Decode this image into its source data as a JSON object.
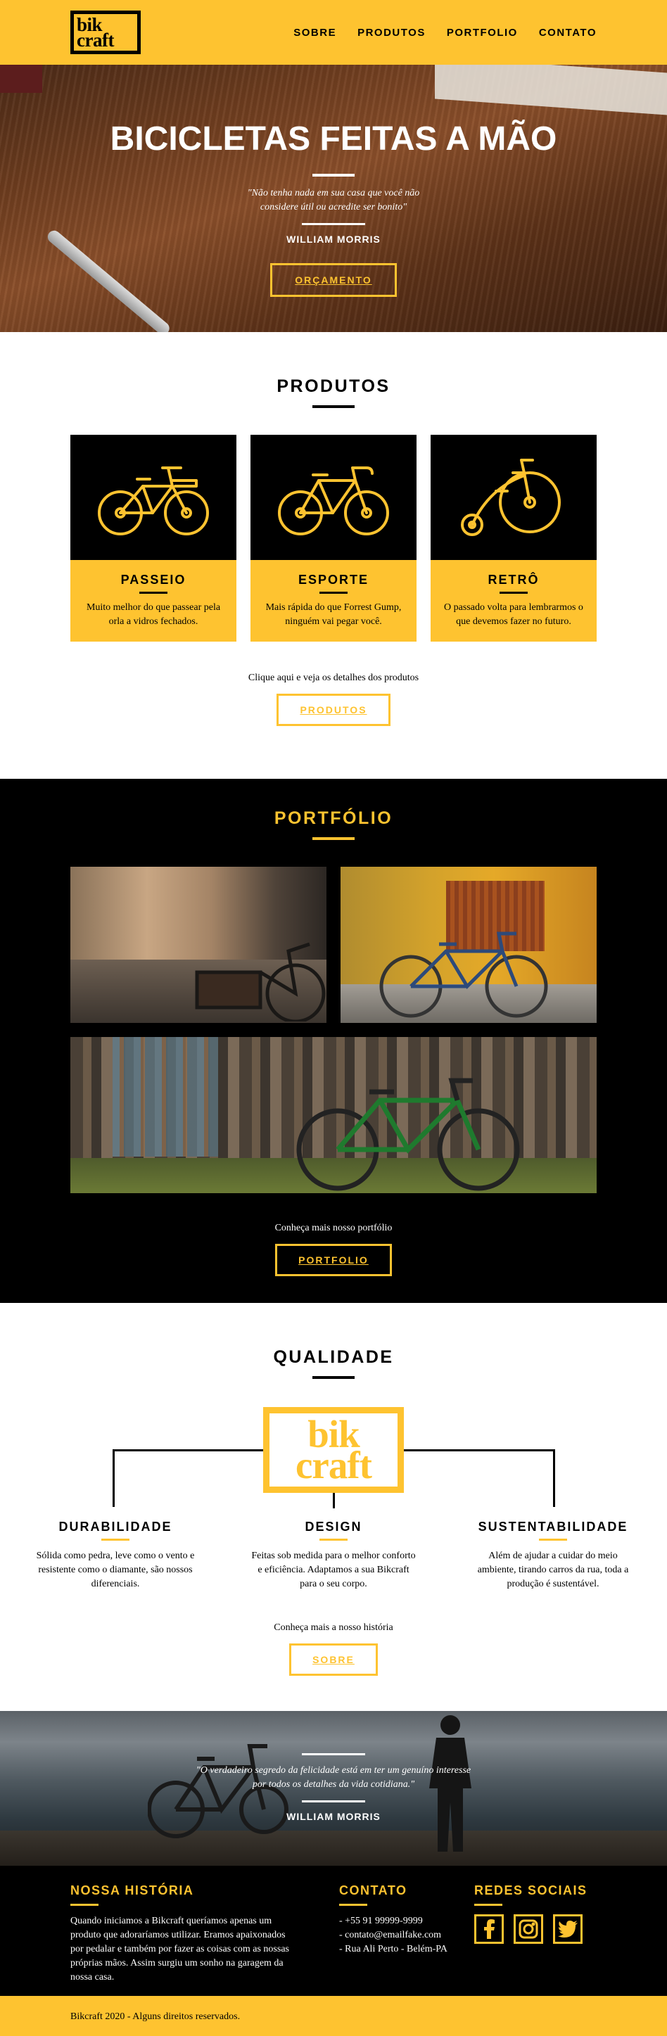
{
  "brand": {
    "logo_line1": "bik",
    "logo_line2": "craft"
  },
  "nav": {
    "items": [
      {
        "label": "SOBRE"
      },
      {
        "label": "PRODUTOS"
      },
      {
        "label": "PORTFOLIO"
      },
      {
        "label": "CONTATO"
      }
    ]
  },
  "hero": {
    "title": "BICICLETAS FEITAS A MÃO",
    "quote": "\"Não tenha nada em sua casa que você não considere útil ou acredite ser bonito\"",
    "author": "WILLIAM MORRIS",
    "button": "ORÇAMENTO"
  },
  "produtos": {
    "title": "PRODUTOS",
    "cards": [
      {
        "name": "PASSEIO",
        "desc": "Muito melhor do que passear pela orla a vidros fechados.",
        "icon": "city-bike-icon"
      },
      {
        "name": "ESPORTE",
        "desc": "Mais rápida do que Forrest Gump, ninguém vai pegar você.",
        "icon": "sport-bike-icon"
      },
      {
        "name": "RETRÔ",
        "desc": "O passado volta para lembrarmos o que devemos fazer no futuro.",
        "icon": "retro-bike-icon"
      }
    ],
    "cta_text": "Clique aqui e veja os detalhes dos produtos",
    "button": "PRODUTOS"
  },
  "portfolio": {
    "title": "PORTFÓLIO",
    "cta_text": "Conheça mais nosso portfólio",
    "button": "PORTFOLIO"
  },
  "qualidade": {
    "title": "QUALIDADE",
    "logo_line1": "bik",
    "logo_line2": "craft",
    "items": [
      {
        "name": "DURABILIDADE",
        "desc": "Sólida como pedra, leve como o vento e resistente como o diamante, são nossos diferenciais."
      },
      {
        "name": "DESIGN",
        "desc": "Feitas sob medida para o melhor conforto e eficiência. Adaptamos a sua Bikcraft para o seu corpo."
      },
      {
        "name": "SUSTENTABILIDADE",
        "desc": "Além de ajudar a cuidar do meio ambiente, tirando carros da rua, toda a produção é sustentável."
      }
    ],
    "cta_text": "Conheça mais a nosso história",
    "button": "SOBRE"
  },
  "quote2": {
    "quote": "\"O verdadeiro segredo da felicidade está em ter um genuíno interesse por todos os detalhes da vida cotidiana.\"",
    "author": "WILLIAM MORRIS"
  },
  "footer": {
    "historia": {
      "title": "NOSSA HISTÓRIA",
      "text": "Quando iniciamos a Bikcraft queríamos apenas um produto que adoraríamos utilizar. Eramos apaixonados por pedalar e também por fazer as coisas com as nossas próprias mãos. Assim surgiu um sonho na garagem da nossa casa."
    },
    "contato": {
      "title": "CONTATO",
      "lines": [
        "- +55 91 99999-9999",
        "- contato@emailfake.com",
        "- Rua Ali Perto - Belém-PA"
      ]
    },
    "redes": {
      "title": "REDES SOCIAIS",
      "icons": [
        "facebook-icon",
        "instagram-icon",
        "twitter-icon"
      ]
    },
    "copyright": "Bikcraft 2020 - Alguns direitos reservados."
  },
  "colors": {
    "accent": "#FEC330",
    "dark": "#000000",
    "light": "#FFFFFF"
  }
}
